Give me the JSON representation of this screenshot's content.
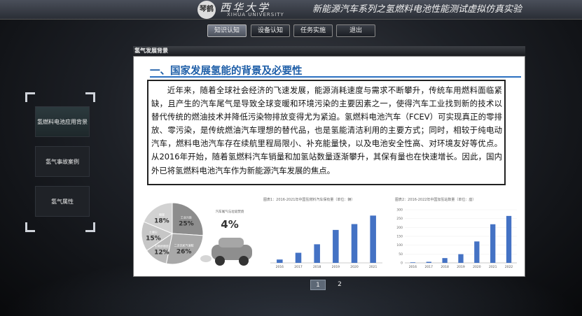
{
  "header": {
    "logo_text": "琴鹤",
    "university_name": "西华大学",
    "university_en": "XIHUA UNIVERSITY",
    "app_title": "新能源汽车系列之氢燃料电池性能测试虚拟仿真实验"
  },
  "nav": [
    "知识认知",
    "设备认知",
    "任务实施",
    "退出"
  ],
  "panel": {
    "header": "氢气发展背景",
    "heading": "一、国家发展氢能的背景及必要性",
    "body": "近年来，随着全球社会经济的飞速发展，能源消耗速度与需求不断攀升，传统车用燃料面临紧缺，且产生的汽车尾气是导致全球变暖和环境污染的主要因素之一，使得汽车工业找到新的技术以替代传统的燃油技术并降低污染物排放变得尤为紧迫。氢燃料电池汽车（FCEV）可实现真正的零排放、零污染，是传统燃油汽车理想的替代品，也是氢能清洁利用的主要方式；同时，相较于纯电动汽车，燃料电池汽车存在续航里程局限小、补充能量快，以及电池安全性高、对环境友好等优点。从2016年开始，随着氢燃料汽车销量和加氢站数量逐渐攀升，其保有量也在快速增长。因此，国内外已将氢燃料电池汽车作为新能源汽车发展的焦点。"
  },
  "sidebar": [
    "氢燃料电池应用背景",
    "氢气事故案例",
    "氢气属性"
  ],
  "pagination": [
    "1",
    "2"
  ],
  "chart_data": [
    {
      "type": "pie",
      "labels": [
        "工业污染",
        "二次无机气溶胶",
        "生物质燃烧",
        "土壤尘",
        "燃煤",
        "汽车尾气与垃圾焚烧"
      ],
      "values": [
        25,
        26,
        12,
        15,
        18,
        4
      ],
      "value_labels": [
        "25%",
        "26%",
        "12%",
        "15%",
        "18%",
        "4%"
      ]
    },
    {
      "type": "bar",
      "title": "图表1：2016-2021年中国氢燃料汽车保有量（单位：辆）",
      "categories": [
        "2016",
        "2017",
        "2018",
        "2019",
        "2020",
        "2021"
      ],
      "values": [
        629,
        1900,
        3500,
        6200,
        7300,
        8900
      ],
      "ylim": [
        0,
        10000
      ]
    },
    {
      "type": "bar",
      "title": "图表2：2016-2022年中国加氢站数量（单位：座）",
      "categories": [
        "2016",
        "2017",
        "2018",
        "2019",
        "2020",
        "2021",
        "2022"
      ],
      "values": [
        3,
        6,
        27,
        49,
        121,
        218,
        265
      ],
      "ylim": [
        0,
        300
      ],
      "yticks": [
        "0",
        "50",
        "100",
        "150",
        "200",
        "250",
        "300"
      ]
    }
  ],
  "colors": {
    "heading": "#1f5fa8",
    "bar": "#4472c4",
    "pie_base": "#9a9a9a"
  }
}
